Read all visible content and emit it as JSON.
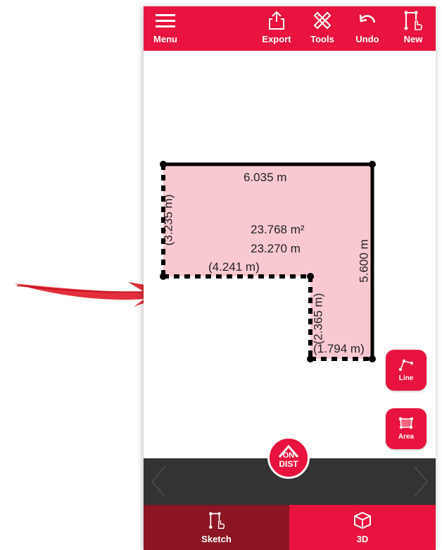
{
  "toolbar": {
    "menu_label": "Menu",
    "export_label": "Export",
    "tools_label": "Tools",
    "undo_label": "Undo",
    "new_label": "New"
  },
  "sketch": {
    "top_length": "6.035 m",
    "left_length": "(3.235 m)",
    "right_length": "5.600 m",
    "inner_horizontal_length": "(4.241 m)",
    "inner_vertical_length": "(2.365 m)",
    "bottom_length": "(1.794 m)",
    "area": "23.768 m²",
    "perimeter": "23.270 m"
  },
  "tools": {
    "line_label": "Line",
    "area_label": "Area"
  },
  "ondist": {
    "line1": "ON",
    "line2": "DIST"
  },
  "tabs": {
    "sketch_label": "Sketch",
    "threed_label": "3D"
  },
  "colors": {
    "accent": "#e8133e",
    "tab_active": "#8b1522",
    "dark_bar": "#333333",
    "shape_fill": "#f9c9d2"
  }
}
